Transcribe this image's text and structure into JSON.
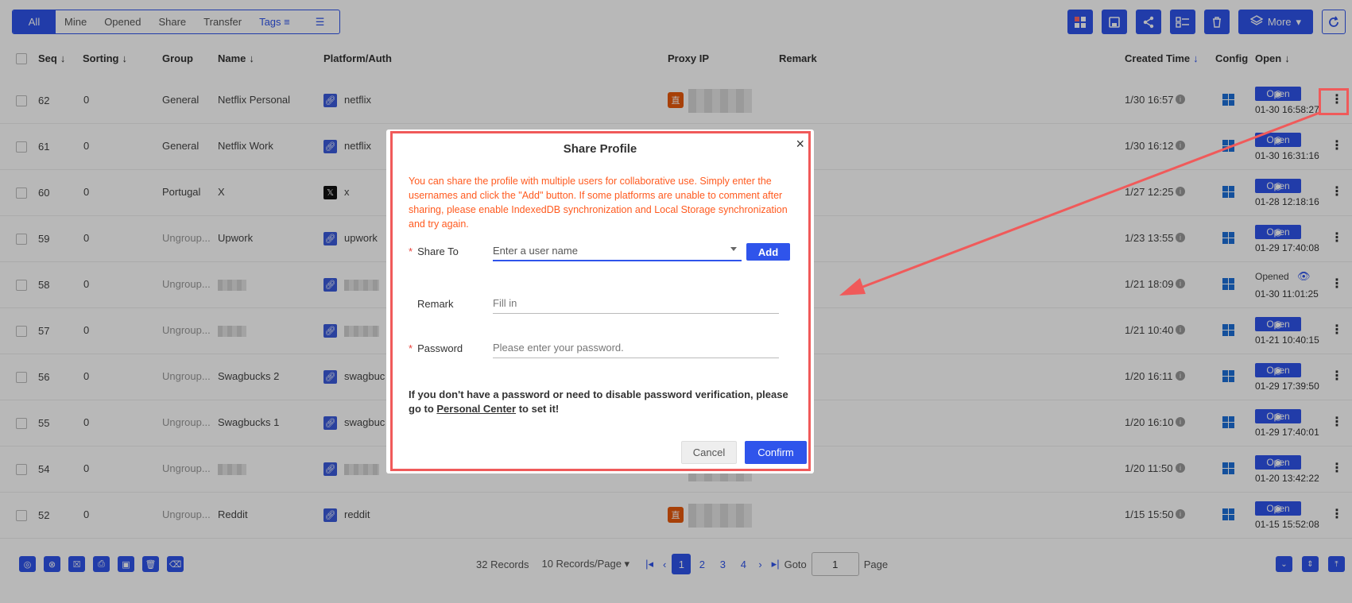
{
  "filter_tabs": [
    "All",
    "Mine",
    "Opened",
    "Share",
    "Transfer",
    "Tags"
  ],
  "toolbar": {
    "more_label": "More"
  },
  "columns": {
    "seq": "Seq",
    "sorting": "Sorting",
    "group": "Group",
    "name": "Name",
    "platform": "Platform/Auth",
    "proxy": "Proxy IP",
    "remark": "Remark",
    "created": "Created Time",
    "config": "Config",
    "open": "Open"
  },
  "rows": [
    {
      "seq": "62",
      "sorting": "0",
      "group": "General",
      "name": "Netflix Personal",
      "platform": "netflix",
      "created": "1/30 16:57",
      "status": "Open",
      "time": "01-30 16:58:27"
    },
    {
      "seq": "61",
      "sorting": "0",
      "group": "General",
      "name": "Netflix Work",
      "platform": "netflix",
      "created": "1/30 16:12",
      "status": "Open",
      "time": "01-30 16:31:16"
    },
    {
      "seq": "60",
      "sorting": "0",
      "group": "Portugal",
      "name": "X",
      "platform": "x",
      "created": "1/27 12:25",
      "status": "Open",
      "time": "01-28 12:18:16"
    },
    {
      "seq": "59",
      "sorting": "0",
      "group": "Ungroup...",
      "name": "Upwork",
      "platform": "upwork",
      "created": "1/23 13:55",
      "status": "Open",
      "time": "01-29 17:40:08"
    },
    {
      "seq": "58",
      "sorting": "0",
      "group": "Ungroup...",
      "name": "",
      "platform": "",
      "created": "1/21 18:09",
      "status": "Opened",
      "time": "01-30 11:01:25"
    },
    {
      "seq": "57",
      "sorting": "0",
      "group": "Ungroup...",
      "name": "",
      "platform": "",
      "created": "1/21 10:40",
      "status": "Open",
      "time": "01-21 10:40:15"
    },
    {
      "seq": "56",
      "sorting": "0",
      "group": "Ungroup...",
      "name": "Swagbucks 2",
      "platform": "swagbuc",
      "created": "1/20 16:11",
      "status": "Open",
      "time": "01-29 17:39:50"
    },
    {
      "seq": "55",
      "sorting": "0",
      "group": "Ungroup...",
      "name": "Swagbucks 1",
      "platform": "swagbuc",
      "created": "1/20 16:10",
      "status": "Open",
      "time": "01-29 17:40:01"
    },
    {
      "seq": "54",
      "sorting": "0",
      "group": "Ungroup...",
      "name": "",
      "platform": "",
      "created": "1/20 11:50",
      "status": "Open",
      "time": "01-20 13:42:22"
    },
    {
      "seq": "52",
      "sorting": "0",
      "group": "Ungroup...",
      "name": "Reddit",
      "platform": "reddit",
      "created": "1/15 15:50",
      "status": "Open",
      "time": "01-15 15:52:08"
    }
  ],
  "pager": {
    "records": "32 Records",
    "per_page": "10 Records/Page",
    "pages": [
      "1",
      "2",
      "3",
      "4"
    ],
    "goto": "Goto",
    "goto_value": "1",
    "page": "Page"
  },
  "modal": {
    "title": "Share Profile",
    "close": "×",
    "notice": "You can share the profile with multiple users for collaborative use. Simply enter the usernames and click the \"Add\" button. If some platforms are unable to comment after sharing, please enable IndexedDB synchronization and Local Storage synchronization and try again.",
    "share_to_label": "Share To",
    "share_to_placeholder": "Enter a user name",
    "add_label": "Add",
    "remark_label": "Remark",
    "remark_placeholder": "Fill in",
    "password_label": "Password",
    "password_placeholder": "Please enter your password.",
    "hint_pre": "If you don't have a password or need to disable password verification, please go to ",
    "hint_link": "Personal Center",
    "hint_post": " to set it!",
    "cancel_label": "Cancel",
    "confirm_label": "Confirm"
  },
  "colors": {
    "accent": "#2f54eb",
    "annotation": "#f05a5a",
    "warning": "#ff5a1f"
  }
}
